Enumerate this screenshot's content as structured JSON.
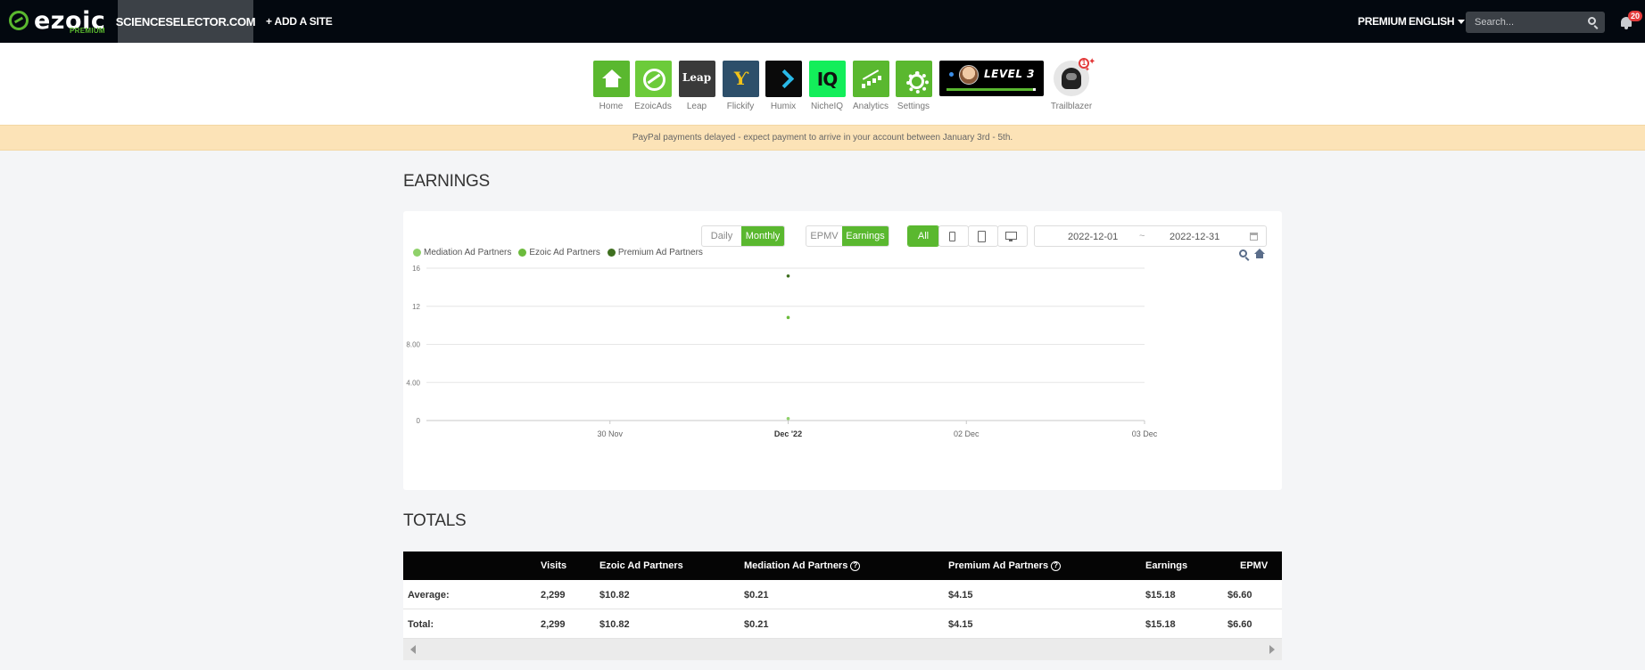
{
  "topbar": {
    "logo_text": "ezoic",
    "logo_sub": "PREMIUM",
    "site_tab": "SCIENCESELECTOR.COM",
    "add_site": "+ ADD A SITE",
    "premium": "PREMIUM",
    "language": "ENGLISH",
    "search_placeholder": "Search...",
    "notifications_count": "20"
  },
  "apps": [
    {
      "label": "Home",
      "icon": "home-icon",
      "color": "#5ab82f"
    },
    {
      "label": "EzoicAds",
      "icon": "ezoic-ads-icon",
      "color": "#6ccb3a"
    },
    {
      "label": "Leap",
      "icon": "leap-icon",
      "color": "#3a3a3a",
      "text": "Leap"
    },
    {
      "label": "Flickify",
      "icon": "flickify-icon",
      "color": "#2d4f6a",
      "text": "Ƴ"
    },
    {
      "label": "Humix",
      "icon": "humix-icon",
      "color": "#0a0a0a"
    },
    {
      "label": "NicheIQ",
      "icon": "nicheiq-icon",
      "color": "#13ee5a",
      "text": "IQ"
    },
    {
      "label": "Analytics",
      "icon": "analytics-icon",
      "color": "#5ab82f"
    },
    {
      "label": "Settings",
      "icon": "settings-icon",
      "color": "#5ab82f"
    }
  ],
  "level": {
    "text": "LEVEL 3",
    "progress": 0.97
  },
  "trailblazer": {
    "label": "Trailblazer",
    "badge": "1"
  },
  "notice": "PayPal payments delayed - expect payment to arrive in your account between January 3rd - 5th.",
  "earnings": {
    "title": "EARNINGS",
    "period_options": [
      "Daily",
      "Monthly"
    ],
    "period_selected": "Monthly",
    "metric_options": [
      "EPMV",
      "Earnings"
    ],
    "metric_selected": "Earnings",
    "device_all": "All",
    "date_from": "2022-12-01",
    "date_sep": "~",
    "date_to": "2022-12-31"
  },
  "chart_data": {
    "type": "scatter",
    "legend_position": "top-left",
    "series": [
      {
        "name": "Mediation Ad Partners",
        "color": "#8fd16a",
        "points": [
          {
            "x": "2022-12-01",
            "y": 0.21
          }
        ]
      },
      {
        "name": "Ezoic Ad Partners",
        "color": "#6cbb3c",
        "points": [
          {
            "x": "2022-12-01",
            "y": 10.82
          }
        ]
      },
      {
        "name": "Premium Ad Partners",
        "color": "#3e6f1f",
        "points": [
          {
            "x": "2022-12-01",
            "y": 15.18
          }
        ]
      }
    ],
    "ylim": [
      0,
      16
    ],
    "yticks": [
      {
        "v": 0,
        "label": "0"
      },
      {
        "v": 4,
        "label": "4.00"
      },
      {
        "v": 8,
        "label": "8.00"
      },
      {
        "v": 12,
        "label": "12"
      },
      {
        "v": 16,
        "label": "16"
      }
    ],
    "xlim": [
      "2022-11-29",
      "2022-12-03"
    ],
    "xticks": [
      {
        "x": "2022-11-30",
        "label": "30 Nov",
        "bold": false
      },
      {
        "x": "2022-12-01",
        "label": "Dec '22",
        "bold": true
      },
      {
        "x": "2022-12-02",
        "label": "02 Dec",
        "bold": false
      },
      {
        "x": "2022-12-03",
        "label": "03 Dec",
        "bold": false
      }
    ],
    "grid": true
  },
  "totals": {
    "title": "TOTALS",
    "columns": [
      "",
      "Visits",
      "Ezoic Ad Partners",
      "Mediation Ad Partners",
      "Premium Ad Partners",
      "Earnings",
      "EPMV"
    ],
    "help_columns": [
      3,
      4
    ],
    "rows": [
      [
        "Average:",
        "2,299",
        "$10.82",
        "$0.21",
        "$4.15",
        "$15.18",
        "$6.60"
      ],
      [
        "Total:",
        "2,299",
        "$10.82",
        "$0.21",
        "$4.15",
        "$15.18",
        "$6.60"
      ]
    ]
  }
}
